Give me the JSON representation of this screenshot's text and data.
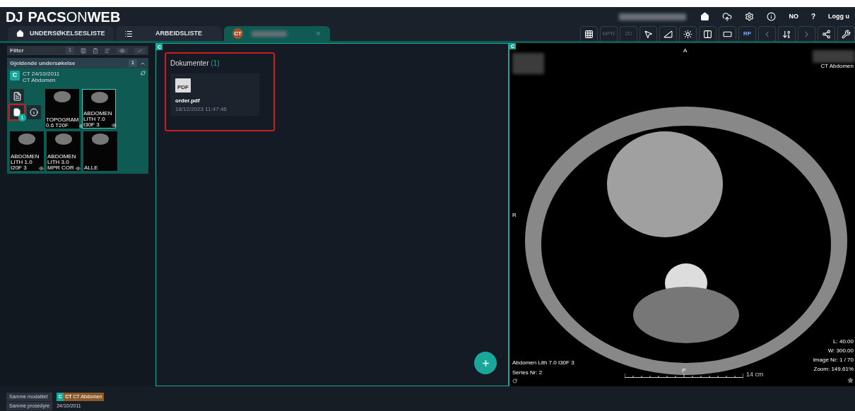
{
  "header": {
    "logo_mark": "DJ",
    "logo_a": "PACS",
    "logo_b": "ON",
    "logo_c": "WEB",
    "language": "NO",
    "help": "?",
    "logout": "Logg u"
  },
  "tabs": [
    {
      "kind": "home",
      "label": "UNDERSØKELSESLISTE",
      "selected": false
    },
    {
      "kind": "list",
      "label": "ARBEIDSLISTE",
      "selected": false
    },
    {
      "kind": "study",
      "badge": "CT",
      "selected": true
    }
  ],
  "toolbar": [
    {
      "kind": "grid"
    },
    {
      "kind": "text",
      "label": "MPR",
      "disabled": true
    },
    {
      "kind": "text",
      "label": "2D",
      "disabled": true
    },
    {
      "kind": "pointer"
    },
    {
      "kind": "ruler"
    },
    {
      "kind": "brightness"
    },
    {
      "kind": "split"
    },
    {
      "kind": "layout"
    },
    {
      "kind": "text",
      "label": "RP",
      "disabled": false
    },
    {
      "kind": "prev"
    },
    {
      "kind": "sort"
    },
    {
      "kind": "next"
    },
    {
      "kind": "share"
    },
    {
      "kind": "tools"
    }
  ],
  "filter": {
    "label": "Filter",
    "count": "1"
  },
  "group": {
    "title": "Gjeldende undersøkelse",
    "count": "1",
    "expanded": true
  },
  "study": {
    "letter": "C",
    "title": "CT 24/10/2011",
    "subtitle": "CT Abdomen"
  },
  "documents_icons": [
    {
      "kind": "report",
      "selected": false
    },
    {
      "kind": "document",
      "selected": true,
      "badge": "1"
    },
    {
      "kind": "info",
      "selected": false
    }
  ],
  "thumbnails": [
    {
      "label": "TOPOGRAM 0.6 T20F",
      "selected": false,
      "eye": true
    },
    {
      "label": "ABDOMEN LITH 7.0 I30F 3",
      "selected": true,
      "eye": true
    },
    {
      "label": "ABDOMEN LITH 1.0 I20F 3",
      "selected": false,
      "eye": true
    },
    {
      "label": "ABDOMEN LITH 3.0 MPR COR",
      "selected": false,
      "eye": true
    },
    {
      "label": "ALLE",
      "selected": false,
      "eye": false
    }
  ],
  "documents": {
    "marker": "C",
    "title": "Dokumenter",
    "count": "(1)",
    "files": [
      {
        "icon_text": "PDF",
        "name": "order.pdf",
        "date": "18/12/2023 11:47:46"
      }
    ]
  },
  "viewer": {
    "marker": "C",
    "top": "A",
    "left": "R",
    "study": "CT Abdomen",
    "series": "Abdomen Lith 7.0 I30F 3",
    "series_nr": "Series Nr: 2",
    "level": "L: 40.00",
    "width": "W: 300.00",
    "image_nr": "Image Nr: 1 / 70",
    "zoom": "Zoom: 149.61%",
    "scale_mark": "P",
    "scale": "14 cm"
  },
  "bottom": {
    "buttons": [
      "Samme modalitet",
      "Samme prosedyre"
    ],
    "chip": {
      "letter": "C",
      "modality": "CT",
      "name": "CT Abdomen",
      "date": "24/10/2011"
    }
  }
}
